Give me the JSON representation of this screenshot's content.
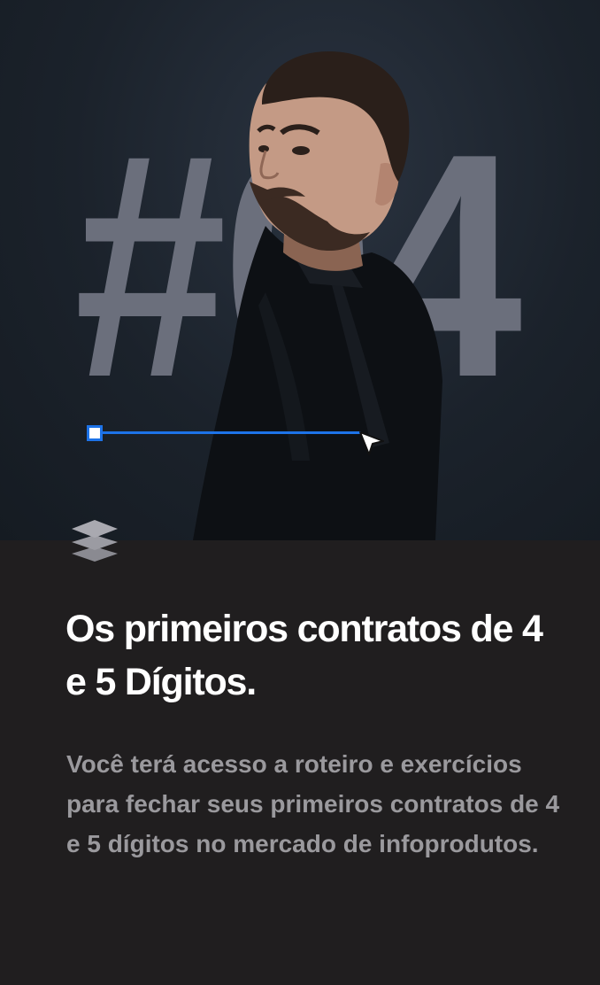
{
  "hero": {
    "number_text": "#04",
    "icon": "person-photo",
    "selection_line_color": "#1d73e8"
  },
  "card": {
    "icon": "layers-icon",
    "title": "Os primeiros contratos de 4 e 5 Dígitos.",
    "description": "Você terá acesso a roteiro e exercícios para fechar seus primeiros contratos de 4 e 5 dígitos no mercado de infoprodutos."
  },
  "colors": {
    "hero_background": "#1b222b",
    "hero_number": "#6b6f7c",
    "card_background": "#201e1f",
    "title": "#ffffff",
    "description": "#9a999d",
    "accent": "#1d73e8"
  }
}
